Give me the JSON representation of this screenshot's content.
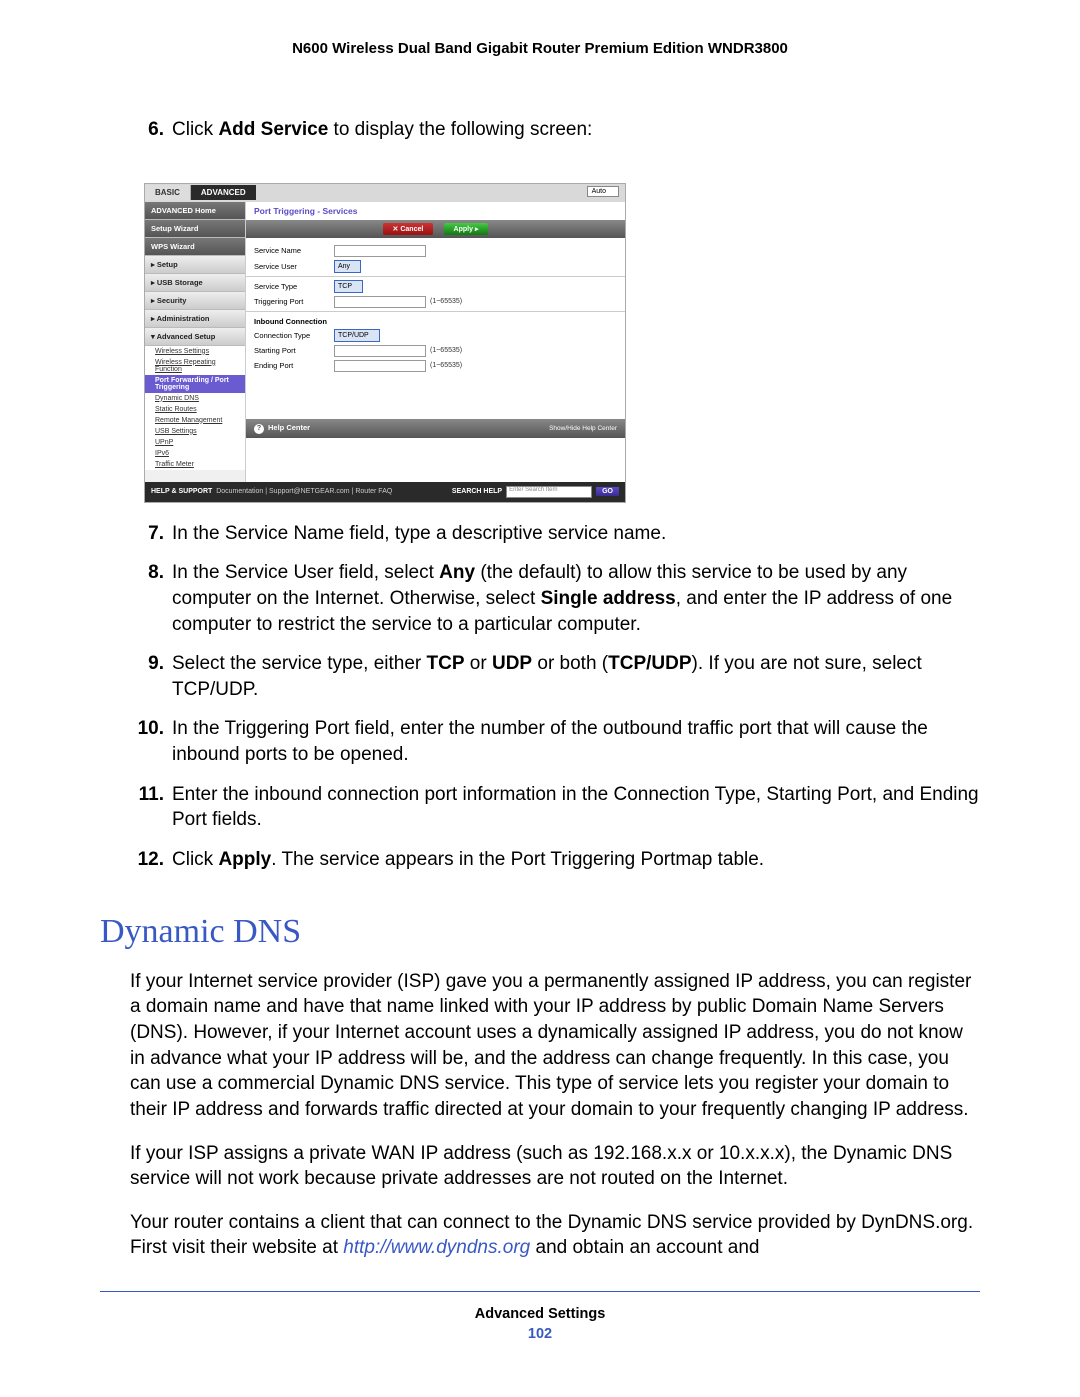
{
  "header": {
    "title": "N600 Wireless Dual Band Gigabit Router Premium Edition WNDR3800"
  },
  "steps": [
    {
      "n": "6.",
      "pre": "Click ",
      "bold": "Add Service",
      "post": " to display the following screen:"
    }
  ],
  "router": {
    "tabs": {
      "basic": "BASIC",
      "advanced": "ADVANCED",
      "auto": "Auto"
    },
    "sidebar": {
      "items": [
        "ADVANCED Home",
        "Setup Wizard",
        "WPS Wizard",
        "▸ Setup",
        "▸ USB Storage",
        "▸ Security",
        "▸ Administration",
        "▾ Advanced Setup"
      ],
      "subs": [
        "Wireless Settings",
        "Wireless Repeating Function",
        "Port Forwarding / Port Triggering",
        "Dynamic DNS",
        "Static Routes",
        "Remote Management",
        "USB Settings",
        "UPnP",
        "IPv6",
        "Traffic Meter"
      ],
      "active_index": 2
    },
    "panel": {
      "title": "Port Triggering - Services",
      "cancel": "Cancel",
      "apply": "Apply",
      "fields": {
        "service_name": "Service Name",
        "service_user": "Service User",
        "service_user_val": "Any",
        "service_type": "Service Type",
        "service_type_val": "TCP",
        "trig_port": "Triggering Port",
        "range1": "(1~65535)",
        "inbound": "Inbound Connection",
        "conn_type": "Connection Type",
        "conn_type_val": "TCP/UDP",
        "start_port": "Starting Port",
        "range2": "(1~65535)",
        "end_port": "Ending Port",
        "range3": "(1~65535)"
      },
      "help_center": "Help Center",
      "help_toggle": "Show/Hide Help Center"
    },
    "footer": {
      "help_support": "HELP & SUPPORT",
      "links": "Documentation | Support@NETGEAR.com | Router FAQ",
      "search_label": "SEARCH HELP",
      "placeholder": "Enter Search Item",
      "go": "GO"
    }
  },
  "steps2": [
    {
      "n": "7.",
      "html": "In the Service Name field, type a descriptive service name."
    },
    {
      "n": "8.",
      "html": "In the Service User field, select <b>Any</b> (the default) to allow this service to be used by any computer on the Internet. Otherwise, select <b>Single address</b>, and enter the IP address of one computer to restrict the service to a particular computer."
    },
    {
      "n": "9.",
      "html": "Select the service type, either <b>TCP</b> or <b>UDP</b> or both (<b>TCP/UDP</b>). If you are not sure, select TCP/UDP."
    },
    {
      "n": "10.",
      "html": "In the Triggering Port field, enter the number of the outbound traffic port that will cause the inbound ports to be opened."
    },
    {
      "n": "11.",
      "html": "Enter the inbound connection port information in the Connection Type, Starting Port, and Ending Port fields."
    },
    {
      "n": "12.",
      "html": "Click <b>Apply</b>. The service appears in the Port Triggering Portmap table."
    }
  ],
  "section": {
    "heading": "Dynamic DNS"
  },
  "paragraphs": [
    "If your Internet service provider (ISP) gave you a permanently assigned IP address, you can register a domain name and have that name linked with your IP address by public Domain Name Servers (DNS). However, if your Internet account uses a dynamically assigned IP address, you do not know in advance what your IP address will be, and the address can change frequently. In this case, you can use a commercial Dynamic DNS service. This type of service lets you register your domain to their IP address and forwards traffic directed at your domain to your frequently changing IP address.",
    "If your ISP assigns a private WAN IP address (such as 192.168.x.x or 10.x.x.x), the Dynamic DNS service will not work because private addresses are not routed on the Internet."
  ],
  "para_with_link": {
    "pre": "Your router contains a client that can connect to the Dynamic DNS service provided by DynDNS.org. First visit their website at ",
    "link_text": "http://www.dyndns.org",
    "post": " and obtain an account and"
  },
  "footer": {
    "label": "Advanced Settings",
    "page": "102"
  }
}
